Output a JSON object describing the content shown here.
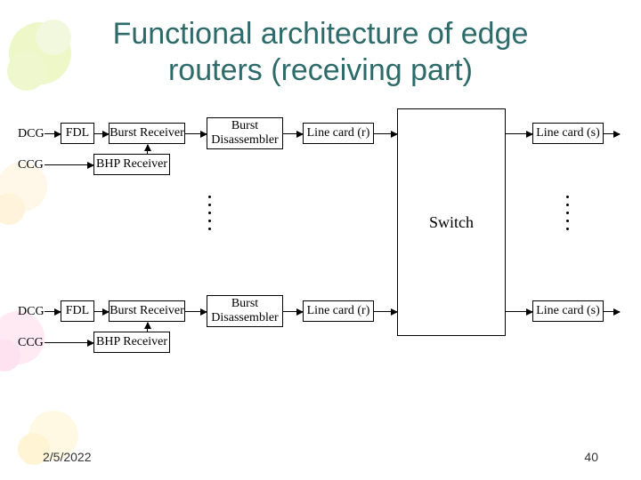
{
  "title_line1": "Functional architecture of edge",
  "title_line2": "routers (receiving part)",
  "footer_date": "2/5/2022",
  "footer_page": "40",
  "labels": {
    "dcg": "DCG",
    "ccg": "CCG",
    "fdl": "FDL",
    "burst_receiver": "Burst Receiver",
    "bhp_receiver": "BHP Receiver",
    "burst_disassembler": "Burst\nDisassembler",
    "line_card_r": "Line card (r)",
    "line_card_s": "Line card (s)",
    "switch": "Switch"
  }
}
